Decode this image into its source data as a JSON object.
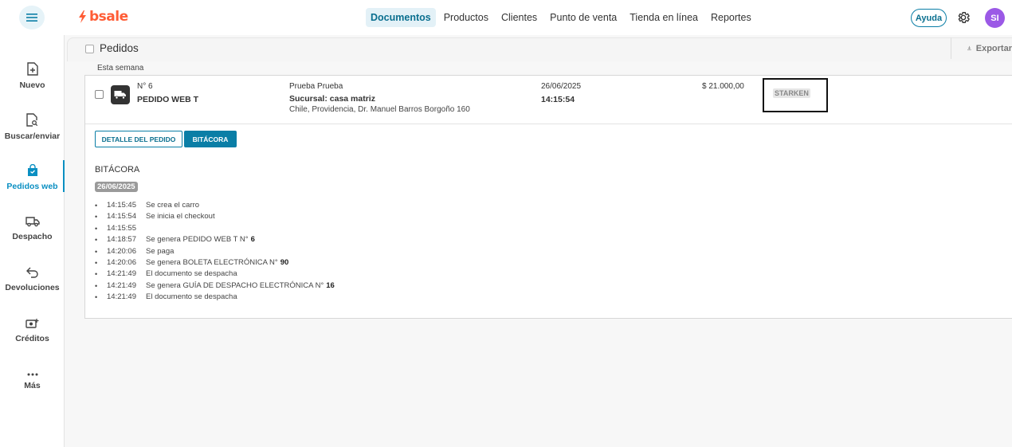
{
  "brand": {
    "name": "bsale",
    "accent": "#ff5c35",
    "primary": "#0a7ea6"
  },
  "topnav": {
    "items": [
      {
        "label": "Documentos",
        "active": true
      },
      {
        "label": "Productos"
      },
      {
        "label": "Clientes"
      },
      {
        "label": "Punto de venta"
      },
      {
        "label": "Tienda en línea"
      },
      {
        "label": "Reportes"
      }
    ],
    "help_label": "Ayuda",
    "avatar_initials": "SI"
  },
  "sidebar": {
    "items": [
      {
        "label": "Nuevo",
        "icon": "file-plus-icon"
      },
      {
        "label": "Buscar/enviar",
        "icon": "file-search-icon"
      },
      {
        "label": "Pedidos web",
        "icon": "shopping-bag-icon",
        "active": true
      },
      {
        "label": "Despacho",
        "icon": "truck-icon"
      },
      {
        "label": "Devoluciones",
        "icon": "return-arrow-icon"
      },
      {
        "label": "Créditos",
        "icon": "money-plus-icon"
      },
      {
        "label": "Más",
        "icon": "more-dots-icon"
      }
    ]
  },
  "list_header": {
    "title": "Pedidos",
    "export_label": "Exportar"
  },
  "group_label": "Esta semana",
  "order": {
    "number": "N° 6",
    "type": "PEDIDO WEB T",
    "customer_name": "Prueba Prueba",
    "branch": "Sucursal: casa matriz",
    "address": "Chile, Providencia, Dr. Manuel Barros Borgoño 160",
    "date": "26/06/2025",
    "time": "14:15:54",
    "amount": "$ 21.000,00",
    "carrier": "STARKEN"
  },
  "tabs": {
    "detail_label": "DETALLE DEL PEDIDO",
    "log_label": "BITÁCORA"
  },
  "log": {
    "title": "BITÁCORA",
    "date": "26/06/2025",
    "entries": [
      {
        "time": "14:15:45",
        "text": "Se crea el carro",
        "bold": ""
      },
      {
        "time": "14:15:54",
        "text": "Se inicia el checkout",
        "bold": ""
      },
      {
        "time": "14:15:55",
        "text": "",
        "bold": ""
      },
      {
        "time": "14:18:57",
        "text": "Se genera PEDIDO WEB T N°",
        "bold": "6"
      },
      {
        "time": "14:20:06",
        "text": "Se paga",
        "bold": ""
      },
      {
        "time": "14:20:06",
        "text": "Se genera BOLETA ELECTRÓNICA N°",
        "bold": "90"
      },
      {
        "time": "14:21:49",
        "text": "El documento se despacha",
        "bold": ""
      },
      {
        "time": "14:21:49",
        "text": "Se genera GUÍA DE DESPACHO ELECTRÓNICA N°",
        "bold": "16"
      },
      {
        "time": "14:21:49",
        "text": "El documento se despacha",
        "bold": ""
      }
    ]
  }
}
